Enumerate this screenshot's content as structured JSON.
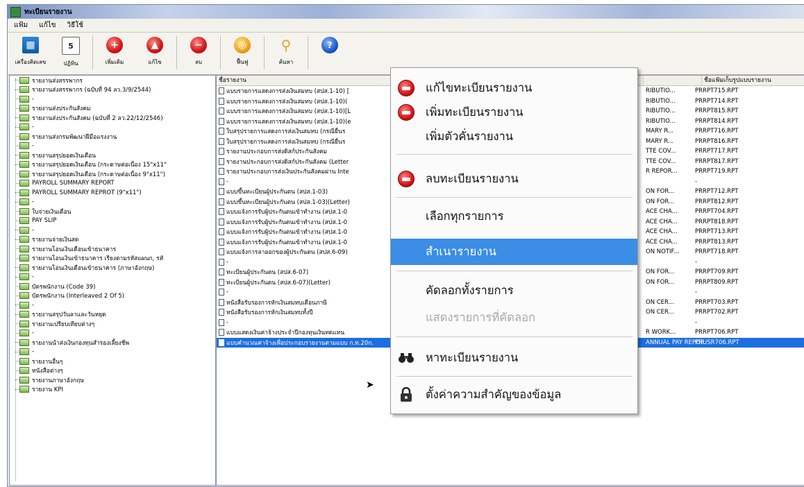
{
  "window": {
    "title": "ทะเบียนรายงาน"
  },
  "menubar": [
    "แฟ้ม",
    "แก้ไข",
    "วิธีใช้"
  ],
  "toolbar": [
    {
      "icon": "calculator-icon",
      "label": "เครื่องคิดเลข"
    },
    {
      "icon": "calendar-icon",
      "label": "ปฏิทิน",
      "glyph": "5"
    },
    {
      "icon": "add-icon",
      "label": "เพิ่มเติม"
    },
    {
      "icon": "edit-icon",
      "label": "แก้ไข"
    },
    {
      "icon": "delete-icon",
      "label": "ลบ"
    },
    {
      "icon": "restore-icon",
      "label": "ฟื้นฟู"
    },
    {
      "icon": "search-icon",
      "label": "ค้นหา"
    },
    {
      "icon": "help-icon",
      "label": "",
      "glyph": "?"
    }
  ],
  "tree": [
    "รายงานส่งสรรพากร",
    "รายงานส่งสรรพากร (ฉบับที่ 94 ลว.3/9/2544)",
    "-",
    "รายงานส่งประกันสังคม",
    "รายงานส่งประกันสังคม (ฉบับที่ 2 ลว.22/12/2546)",
    "-",
    "รายงานส่งกรมพัฒนาฝีมือแรงงาน",
    "-",
    "รายงานสรุปยอดเงินเดือน",
    "รายงานสรุปยอดเงินเดือน (กระดาษต่อเนื่อง 15\"x11\"",
    "รายงานสรุปยอดเงินเดือน (กระดาษต่อเนื่อง 9\"x11\")",
    "PAYROLL SUMMARY REPORT",
    "PAYROLL SUMMARY REPROT (9\"x11\")",
    "-",
    "ใบจ่ายเงินเดือน",
    "PAY SLIP",
    "-",
    "รายงานจ่ายเงินสด",
    "รายงานโอนเงินเดือนเข้าธนาคาร",
    "รายงานโอนเงินเข้าธนาคาร เรียงตามรหัสแผนก, รหั",
    "รายงานโอนเงินเดือนเข้าธนาคาร (ภาษาอังกฤษ)",
    "-",
    "บัตรพนักงาน (Code 39)",
    "บัตรพนักงาน (Interleaved 2 Of 5)",
    "-",
    "รายงานสรุปวันลาและวันหยุด",
    "รายงานเปรียบเทียบต่างๆ",
    "-",
    "รายงานนำส่งเงินกองทุนสำรองเลี้ยงชีพ",
    "-",
    "รายงานอื่นๆ",
    "หนังสือต่างๆ",
    "รายงานภาษาอังกฤษ",
    "รายงาน KPI"
  ],
  "table": {
    "headers": [
      "ชื่อรายงาน",
      "ชื่อแฟ้มเก็บรูปแบบรายงาน"
    ],
    "rows": [
      {
        "name": "แบบรายการแสดงการส่งเงินสมทบ (สปส.1-10) [",
        "eng": "RIBUTIO...",
        "file": "PRRPT715.RPT"
      },
      {
        "name": "แบบรายการแสดงการส่งเงินสมทบ (สปส.1-10)(",
        "eng": "RIBUTIO...",
        "file": "PRRPT714.RPT"
      },
      {
        "name": "แบบรายการแสดงการส่งเงินสมทบ (สปส.1-10)[L",
        "eng": "RIBUTIO...",
        "file": "PRRPT815.RPT"
      },
      {
        "name": "แบบรายการแสดงการส่งเงินสมทบ (สปส.1-10)(e",
        "eng": "RIBUTIO...",
        "file": "PRRPT814.RPT"
      },
      {
        "name": "ใบสรุปรายการแสดงการส่งเงินสมทบ (กรณียื่นร",
        "eng": "MARY R...",
        "file": "PRRPT716.RPT"
      },
      {
        "name": "ใบสรุปรายการแสดงการส่งเงินสมทบ (กรณียื่นร",
        "eng": "MARY R...",
        "file": "PRRPT816.RPT"
      },
      {
        "name": "รายงานประกอบการส่งดิสก์ประกันสังคม",
        "eng": "TTE COV...",
        "file": "PRRPT717.RPT"
      },
      {
        "name": "รายงานประกอบการส่งดิสก์ประกันสังคม (Letter",
        "eng": "TTE COV...",
        "file": "PRRPT817.RPT"
      },
      {
        "name": "รายงานประกอบการส่งเงินประกันสังคมผ่าน Inte",
        "eng": "R REPOR...",
        "file": "PRRPT719.RPT"
      },
      {
        "name": "-",
        "eng": "",
        "file": "-"
      },
      {
        "name": "แบบขึ้นทะเบียนผู้ประกันตน (สปส.1-03)",
        "eng": "ON FOR...",
        "file": "PRRPT712.RPT"
      },
      {
        "name": "แบบขึ้นทะเบียนผู้ประกันตน (สปส.1-03)(Letter)",
        "eng": "ON FOR...",
        "file": "PRRPT812.RPT"
      },
      {
        "name": "แบบแจ้งการรับผู้ประกันตนเข้าทำงาน (สปส.1-0",
        "eng": "ACE CHA...",
        "file": "PRRPT704.RPT"
      },
      {
        "name": "แบบแจ้งการรับผู้ประกันตนเข้าทำงาน (สปส.1-0",
        "eng": "ACE CHA...",
        "file": "PRRPT818.RPT"
      },
      {
        "name": "แบบแจ้งการรับผู้ประกันตนเข้าทำงาน (สปส.1-0",
        "eng": "ACE CHA...",
        "file": "PRRPT713.RPT"
      },
      {
        "name": "แบบแจ้งการรับผู้ประกันตนเข้าทำงาน (สปส.1-0",
        "eng": "ACE CHA...",
        "file": "PRRPT813.RPT"
      },
      {
        "name": "แบบแจ้งการลาออกของผู้ประกันตน (สปส.6-09)",
        "eng": "ON NOTIF...",
        "file": "PRRPT718.RPT"
      },
      {
        "name": "-",
        "eng": "",
        "file": "-"
      },
      {
        "name": "ทะเบียนผู้ประกันตน (สปส.6-07)",
        "eng": "ON FOR...",
        "file": "PRRPT709.RPT"
      },
      {
        "name": "ทะเบียนผู้ประกันตน (สปส.6-07)(Letter)",
        "eng": "ON FOR...",
        "file": "PRRPT809.RPT"
      },
      {
        "name": "-",
        "eng": "",
        "file": "-"
      },
      {
        "name": "หนังสือรับรองการหักเงินสมทบเดือนภาษี",
        "eng": "ON CER...",
        "file": "PRRPT703.RPT"
      },
      {
        "name": "หนังสือรับรองการหักเงินสมทบทั้งปี",
        "eng": "ON CER...",
        "file": "PRRPT702.RPT"
      },
      {
        "name": "-",
        "eng": "",
        "file": "-"
      },
      {
        "name": "แบบแสดงเงินค่าจ้างประจำปีกองทุนเงินทดแทน",
        "eng": "R WORK...",
        "file": "PRRPT706.RPT"
      },
      {
        "name": "แบบคำนวณค่าจ้างเพื่อประกอบรายงานตามแบบ ก.ท.20ก.",
        "eng": "ANNUAL PAY REPORT FOR WORK...",
        "file": "PRUSR706.RPT",
        "selected": true
      }
    ]
  },
  "context_menu": [
    {
      "label": "แก้ไขทะเบียนรายงาน",
      "icon": "edit-icon"
    },
    {
      "label": "เพิ่มทะเบียนรายงาน",
      "icon": "add-icon"
    },
    {
      "label": "เพิ่มตัวคั่นรายงาน",
      "icon": ""
    },
    {
      "label": "ลบทะเบียนรายงาน",
      "icon": "delete-icon"
    },
    {
      "label": "เลือกทุกรายการ",
      "icon": ""
    },
    {
      "label": "สำเนารายงาน",
      "icon": "",
      "highlighted": true
    },
    {
      "label": "คัดลอกทั้งรายการ",
      "icon": ""
    },
    {
      "label": "แสดงรายการที่คัดลอก",
      "icon": "",
      "disabled": true
    },
    {
      "label": "หาทะเบียนรายงาน",
      "icon": "binoculars-icon"
    },
    {
      "label": "ตั้งค่าความสำคัญของข้อมูล",
      "icon": "lock-icon"
    }
  ]
}
